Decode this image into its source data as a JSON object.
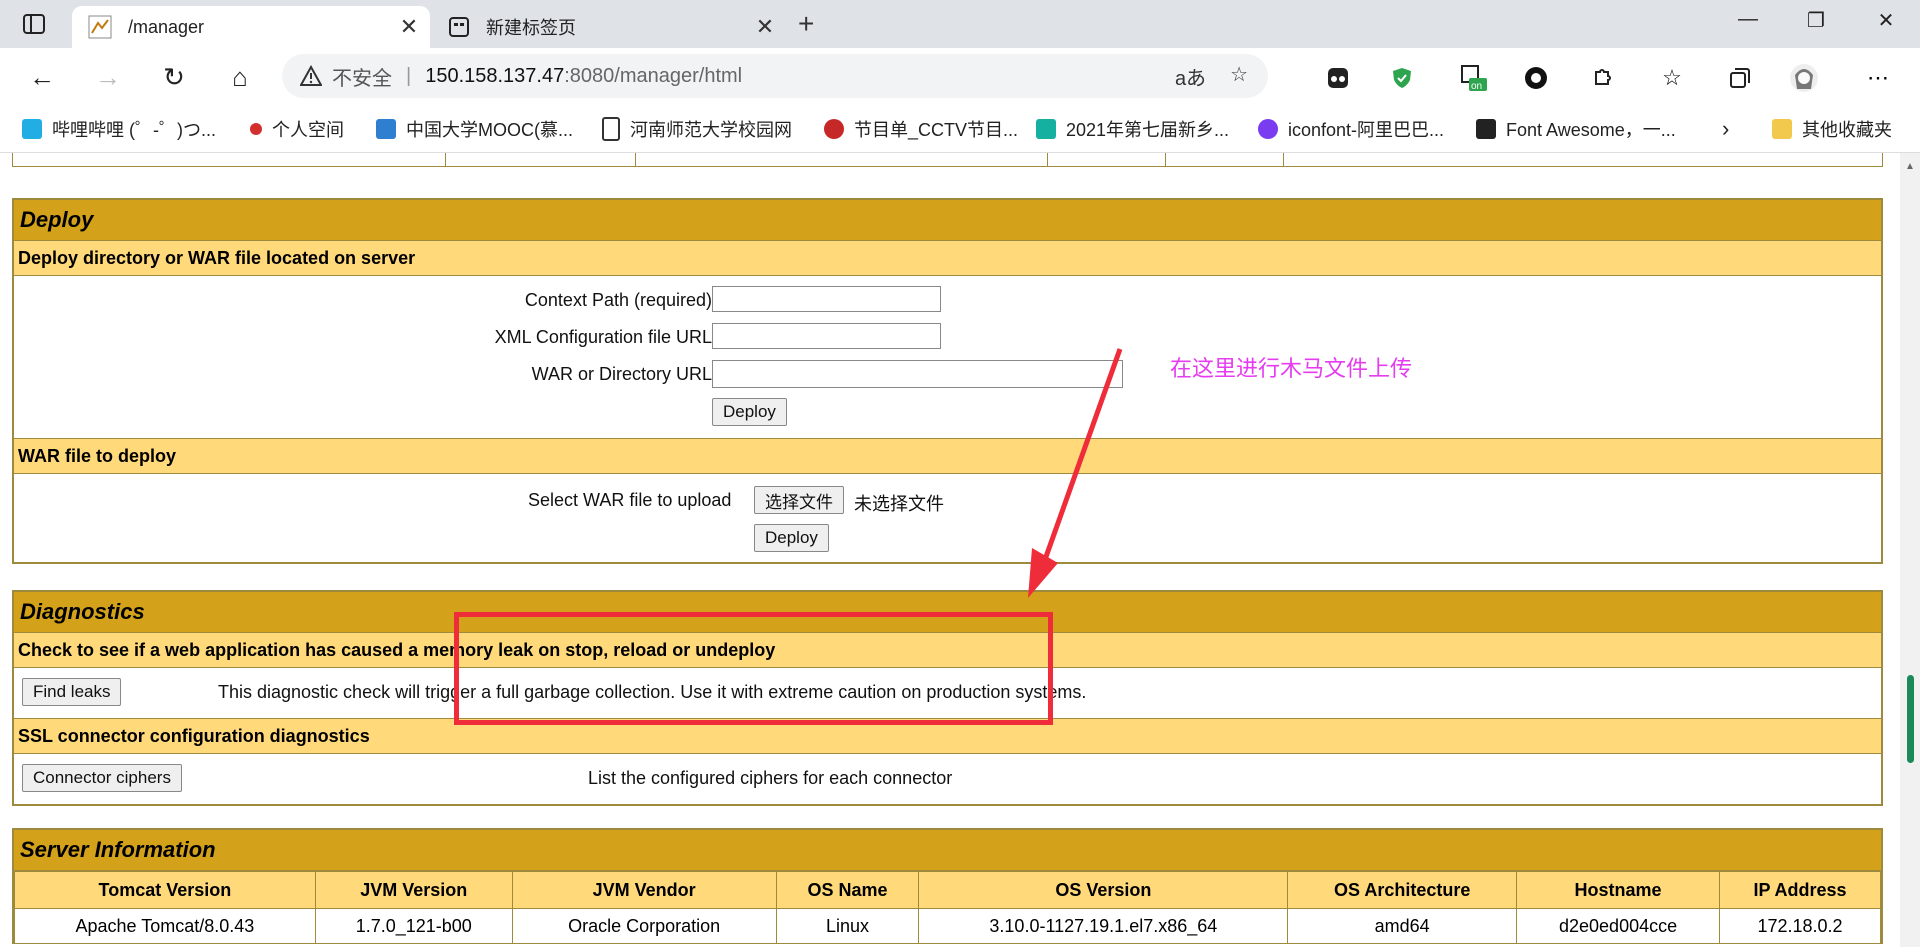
{
  "browser": {
    "tabs": [
      {
        "title": "/manager",
        "active": true
      },
      {
        "title": "新建标签页",
        "active": false
      }
    ],
    "address": {
      "security_label": "不安全",
      "host": "150.158.137.47",
      "rest": ":8080/manager/html"
    },
    "bookmarks": [
      {
        "label": "哔哩哔哩 (゜-゜)つ...",
        "color": "#23ade5"
      },
      {
        "label": "个人空间",
        "color": "#d32f2f"
      },
      {
        "label": "中国大学MOOC(慕...",
        "color": "#2f7fd1"
      },
      {
        "label": "河南师范大学校园网",
        "color": "#ffffff"
      },
      {
        "label": "节目单_CCTV节目...",
        "color": "#c62828"
      },
      {
        "label": "2021年第七届新乡...",
        "color": "#16b0a0"
      },
      {
        "label": "iconfont-阿里巴巴...",
        "color": "#7a3cf0"
      },
      {
        "label": "Font Awesome，一...",
        "color": "#222222"
      }
    ],
    "other_bookmarks": "其他收藏夹"
  },
  "deploy": {
    "title": "Deploy",
    "server_sub": "Deploy directory or WAR file located on server",
    "context_path_label": "Context Path (required):",
    "xml_config_label": "XML Configuration file URL:",
    "war_dir_label": "WAR or Directory URL:",
    "deploy_button": "Deploy",
    "war_sub": "WAR file to deploy",
    "select_label": "Select WAR file to upload",
    "choose_file_button": "选择文件",
    "no_file": "未选择文件",
    "war_deploy_button": "Deploy"
  },
  "diagnostics": {
    "title": "Diagnostics",
    "leak_sub": "Check to see if a web application has caused a memory leak on stop, reload or undeploy",
    "find_leaks_button": "Find leaks",
    "find_leaks_desc": "This diagnostic check will trigger a full garbage collection. Use it with extreme caution on production systems.",
    "ssl_sub": "SSL connector configuration diagnostics",
    "ciphers_button": "Connector ciphers",
    "ciphers_desc": "List the configured ciphers for each connector"
  },
  "server_info": {
    "title": "Server Information",
    "headers": [
      "Tomcat Version",
      "JVM Version",
      "JVM Vendor",
      "OS Name",
      "OS Version",
      "OS Architecture",
      "Hostname",
      "IP Address"
    ],
    "values": [
      "Apache Tomcat/8.0.43",
      "1.7.0_121-b00",
      "Oracle Corporation",
      "Linux",
      "3.10.0-1127.19.1.el7.x86_64",
      "amd64",
      "d2e0ed004cce",
      "172.18.0.2"
    ]
  },
  "annotation": {
    "text": "在这里进行木马文件上传",
    "color": "#e63cf0",
    "box_color": "#ef2d3a"
  }
}
